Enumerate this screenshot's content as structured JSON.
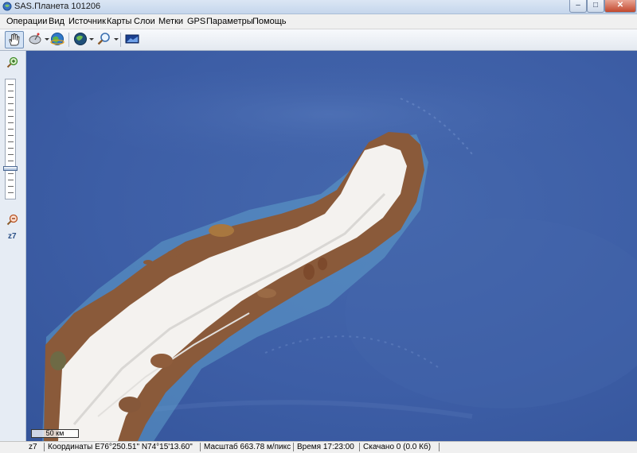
{
  "window": {
    "title": "SAS.Планета 101206",
    "minimize_glyph": "–",
    "maximize_glyph": "□",
    "close_glyph": "✕"
  },
  "menu": {
    "items": [
      "Операции",
      "Вид",
      "Источник",
      "Карты",
      "Слои",
      "Метки",
      "GPS",
      "Параметры",
      "Помощь"
    ]
  },
  "toolbar": {
    "buttons": [
      "hand-icon",
      "satellite-dish-icon",
      "gps-globe-icon",
      "globe-map-icon",
      "magnifier-icon",
      "screen-icon"
    ]
  },
  "left_panel": {
    "zoom_in_icon": "zoom-in-icon",
    "zoom_out_icon": "zoom-out-icon",
    "zoom_label": "z7",
    "zoom_level_fraction": 0.75
  },
  "map": {
    "scale_label": "50 км"
  },
  "status": {
    "zoom": "z7",
    "coords": "Координаты E76°250.51\" N74°15'13.60\"",
    "scale": "Масштаб 663.78 м/пикс",
    "time": "Время 17:23:00",
    "downloaded": "Скачано 0 (0.0 Кб)"
  },
  "colors": {
    "ocean": "#3d5ea6",
    "ice": "#f4f2ef",
    "rock": "#8a5a3a"
  }
}
